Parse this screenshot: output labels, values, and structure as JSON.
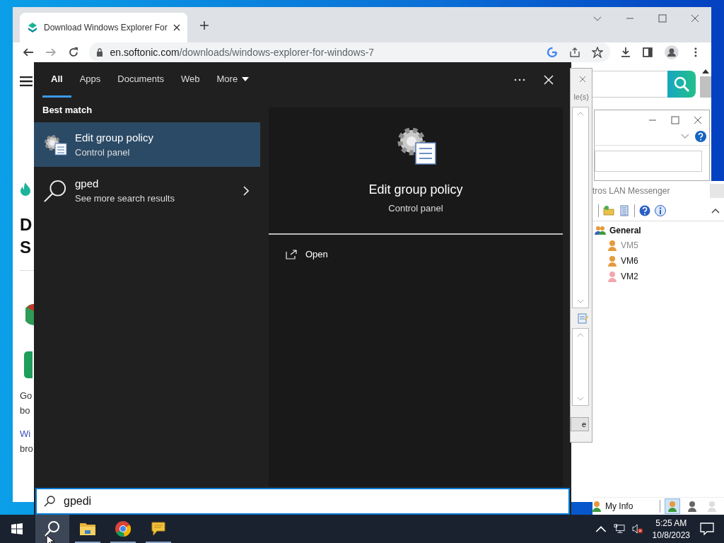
{
  "browser": {
    "tab_title": "Download Windows Explorer For",
    "url_host": "en.softonic.com",
    "url_path": "/downloads/windows-explorer-for-windows-7",
    "page_fragments": [
      {
        "kind": "heading",
        "text": "D"
      },
      {
        "kind": "heading",
        "text": "S"
      },
      {
        "kind": "body",
        "text": "Go"
      },
      {
        "kind": "body",
        "text": "bo"
      },
      {
        "kind": "link",
        "text": "Wi"
      },
      {
        "kind": "body",
        "text": "bro"
      }
    ]
  },
  "dialog": {
    "caption_fragment": "le(s)",
    "button_fragment": "e"
  },
  "messenger": {
    "title": "tros LAN Messenger",
    "group": "General",
    "users": [
      {
        "name": "VM5",
        "color": "#e59a3c",
        "dimmed": true
      },
      {
        "name": "VM6",
        "color": "#e59a3c",
        "dimmed": false
      },
      {
        "name": "VM2",
        "color": "#f2a7ae",
        "dimmed": false
      }
    ],
    "my_info": "My Info",
    "status_buttons": [
      {
        "kind": "available",
        "selected": true
      },
      {
        "kind": "busy",
        "selected": false
      },
      {
        "kind": "invisible",
        "selected": false
      }
    ]
  },
  "search": {
    "tabs": [
      {
        "label": "All",
        "selected": true,
        "has_menu": false
      },
      {
        "label": "Apps",
        "selected": false,
        "has_menu": false
      },
      {
        "label": "Documents",
        "selected": false,
        "has_menu": false
      },
      {
        "label": "Web",
        "selected": false,
        "has_menu": false
      },
      {
        "label": "More",
        "selected": false,
        "has_menu": true
      }
    ],
    "section_title": "Best match",
    "results": [
      {
        "kind": "app",
        "title": "Edit group policy",
        "subtitle": "Control panel",
        "selected": true
      },
      {
        "kind": "web",
        "title": "gped",
        "subtitle": "See more search results",
        "selected": false
      }
    ],
    "preview": {
      "title": "Edit group policy",
      "subtitle": "Control panel",
      "actions": [
        {
          "label": "Open"
        }
      ]
    },
    "query": "gpedi"
  },
  "taskbar": {
    "apps": [
      {
        "kind": "search",
        "selected": true,
        "running": false
      },
      {
        "kind": "files",
        "selected": false,
        "running": true
      },
      {
        "kind": "browser",
        "selected": false,
        "running": true
      },
      {
        "kind": "chat",
        "selected": false,
        "running": true
      }
    ],
    "time": "5:25 AM",
    "date": "10/8/2023"
  }
}
